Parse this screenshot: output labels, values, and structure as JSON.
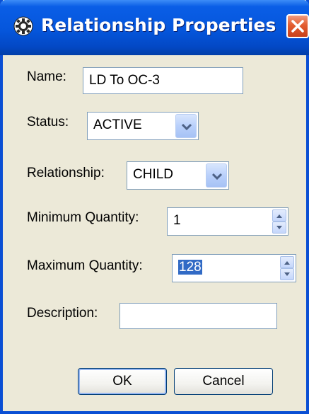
{
  "window": {
    "title": "Relationship Properties",
    "icon": "gear-icon",
    "close_icon": "close-icon"
  },
  "form": {
    "name_label": "Name:",
    "name_value": "LD To OC-3",
    "status_label": "Status:",
    "status_value": "ACTIVE",
    "relationship_label": "Relationship:",
    "relationship_value": "CHILD",
    "min_qty_label": "Minimum Quantity:",
    "min_qty_value": "1",
    "max_qty_label": "Maximum Quantity:",
    "max_qty_value": "128",
    "description_label": "Description:",
    "description_value": ""
  },
  "buttons": {
    "ok_label": "OK",
    "cancel_label": "Cancel"
  },
  "colors": {
    "titlebar": "#0556dc",
    "dialog_bg": "#ece9d8",
    "close_button": "#e35d2f",
    "selection": "#316ac5"
  }
}
